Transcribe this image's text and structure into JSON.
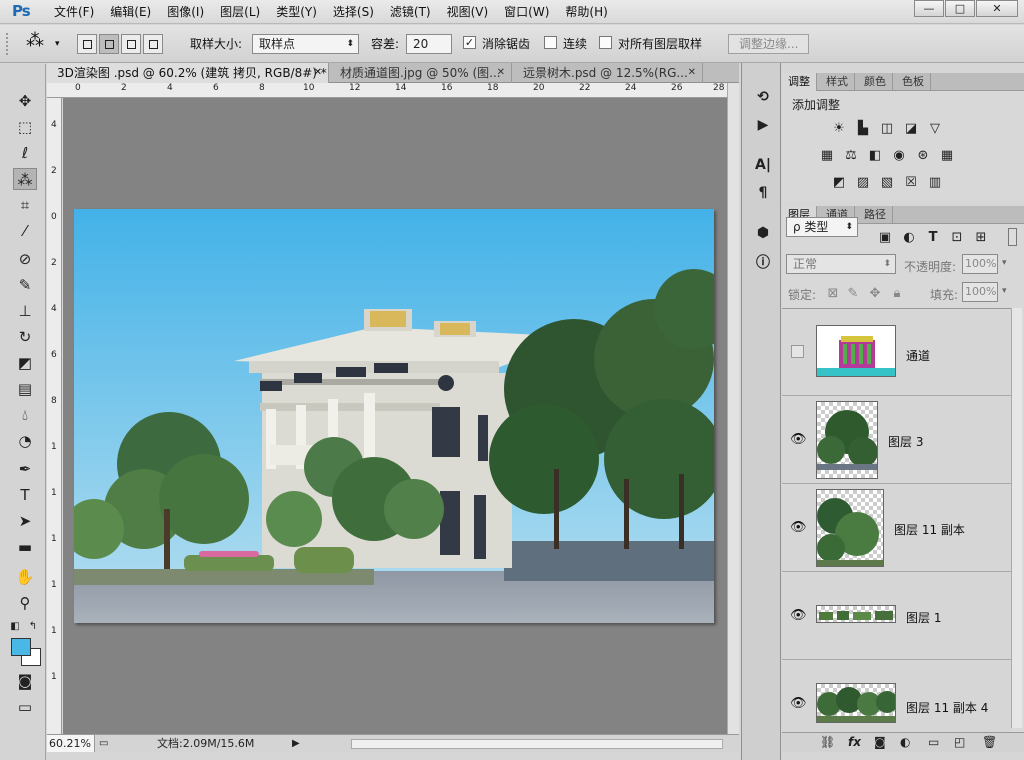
{
  "app": {
    "logo": "Ps",
    "menu": [
      "文件(F)",
      "编辑(E)",
      "图像(I)",
      "图层(L)",
      "类型(Y)",
      "选择(S)",
      "滤镜(T)",
      "视图(V)",
      "窗口(W)",
      "帮助(H)"
    ],
    "window_buttons": [
      "—",
      "□",
      "✕"
    ]
  },
  "options": {
    "sample_size_label": "取样大小:",
    "sample_size_value": "取样点",
    "tolerance_label": "容差:",
    "tolerance_value": "20",
    "anti_alias_label": "消除锯齿",
    "anti_alias_checked": true,
    "contiguous_label": "连续",
    "contiguous_checked": false,
    "all_layers_label": "对所有图层取样",
    "all_layers_checked": false,
    "refine_edge": "调整边缘..."
  },
  "tabs": [
    {
      "label": "3D渲染图 .psd @ 60.2% (建筑 拷贝, RGB/8#) *",
      "active": true
    },
    {
      "label": "材质通道图.jpg @ 50% (图...",
      "active": false
    },
    {
      "label": "远景树木.psd @ 12.5%(RG...",
      "active": false
    }
  ],
  "rulers": {
    "top": [
      "0",
      "2",
      "4",
      "6",
      "8",
      "10",
      "12",
      "14",
      "16",
      "18",
      "20",
      "22",
      "24",
      "26",
      "28"
    ],
    "left": [
      "4",
      "2",
      "0",
      "2",
      "4",
      "6",
      "8",
      "1",
      "1",
      "1",
      "1",
      "1",
      "1"
    ]
  },
  "status": {
    "zoom": "60.21%",
    "doc": "文档:2.09M/15.6M"
  },
  "colors": {
    "foreground": "#4ab8e6",
    "background": "#ffffff",
    "sky_top": "#43b2e8",
    "sky_bottom": "#b7dff0"
  },
  "adjust_panel": {
    "tabs": [
      "调整",
      "样式",
      "颜色",
      "色板"
    ],
    "title": "添加调整"
  },
  "layers_panel": {
    "tabs": [
      "图层",
      "通道",
      "路径"
    ],
    "filter_label": "ρ 类型",
    "blend_mode": "正常",
    "opacity_label": "不透明度:",
    "opacity_value": "100%",
    "lock_label": "锁定:",
    "fill_label": "填充:",
    "fill_value": "100%",
    "layers": [
      {
        "name": "通道",
        "visible": false
      },
      {
        "name": "图层 3",
        "visible": true
      },
      {
        "name": "图层 11 副本",
        "visible": true
      },
      {
        "name": "图层 1",
        "visible": true
      },
      {
        "name": "图层 11 副本 4",
        "visible": true
      }
    ],
    "bottom_icons": [
      "link-icon",
      "fx-icon",
      "mask-icon",
      "adjustment-icon",
      "folder-icon",
      "new-layer-icon",
      "trash-icon"
    ]
  }
}
